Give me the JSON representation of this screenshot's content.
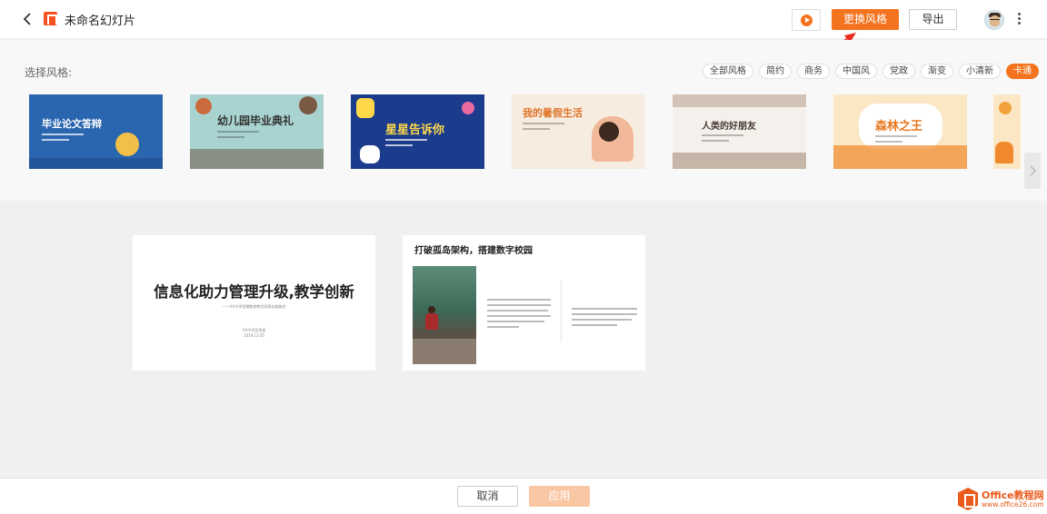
{
  "header": {
    "doc_title": "未命名幻灯片",
    "change_style_label": "更换风格",
    "export_label": "导出"
  },
  "style_panel": {
    "label": "选择风格:",
    "tabs": [
      "全部风格",
      "简约",
      "商务",
      "中国风",
      "党政",
      "渐变",
      "小清新",
      "卡通"
    ],
    "active_tab": "卡通",
    "themes": [
      {
        "title": "毕业论文答辩",
        "bg": "#2a66b0",
        "text_color": "#ffffff"
      },
      {
        "title": "幼儿园毕业典礼",
        "bg": "#a9d3d0",
        "text_color": "#333333"
      },
      {
        "title": "星星告诉你",
        "bg": "#1b3b8c",
        "text_color": "#ffd84a"
      },
      {
        "title": "我的暑假生活",
        "bg": "#f6ede0",
        "text_color": "#e0742a"
      },
      {
        "title": "人类的好朋友",
        "bg": "#f4f1ed",
        "text_color": "#4a3a30"
      },
      {
        "title": "森林之王",
        "bg": "#fbe7c4",
        "text_color": "#e8781e"
      }
    ]
  },
  "slides": [
    {
      "title": "信息化助力管理升级,教学创新",
      "subtitle": "——XX中学智慧教育教学改革实施路径",
      "org": "XX中学信息部",
      "date": "2019.12.05"
    },
    {
      "title": "打破孤岛架构，搭建数字校园"
    }
  ],
  "footer": {
    "cancel_label": "取消",
    "apply_label": "应用"
  },
  "watermark": {
    "name": "Office教程网",
    "url": "www.office26.com"
  }
}
